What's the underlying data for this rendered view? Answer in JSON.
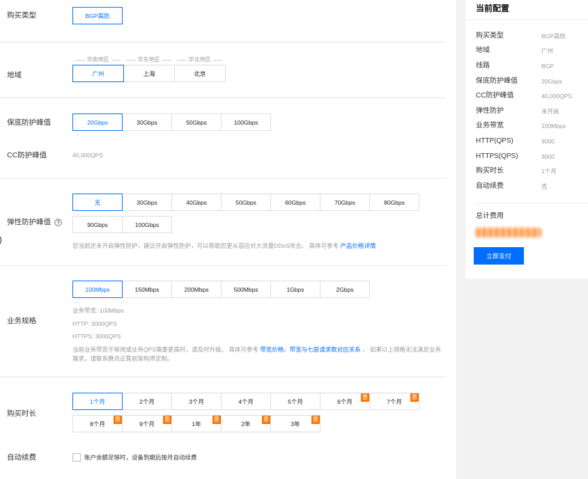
{
  "form": {
    "purchase_type": {
      "label": "购买类型",
      "options": [
        "BGP高防"
      ],
      "selected_index": 0
    },
    "region": {
      "label": "地域",
      "groups": [
        "华南地区",
        "华东地区",
        "华北地区"
      ],
      "options": [
        "广州",
        "上海",
        "北京"
      ],
      "selected_index": 0
    },
    "base_protection": {
      "label": "保底防护峰值",
      "options": [
        "20Gbps",
        "30Gbps",
        "50Gbps",
        "100Gbps"
      ],
      "selected_index": 0
    },
    "cc_protection": {
      "label": "CC防护峰值",
      "value": "40,000QPS"
    },
    "elastic_protection": {
      "label": "弹性防护峰值",
      "help_icon": "question-circle-icon",
      "options": [
        "无",
        "30Gbps",
        "40Gbps",
        "50Gbps",
        "60Gbps",
        "70Gbps",
        "80Gbps",
        "90Gbps",
        "100Gbps"
      ],
      "selected_index": 0,
      "note": "您当前还未开启弹性防护，建议开启弹性防护，可以帮助您更从容应对大流量DDoS攻击。 具体可参考 ",
      "note_link": "产品价格详情"
    },
    "business_spec": {
      "label": "业务规格",
      "options": [
        "100Mbps",
        "150Mbps",
        "200Mbps",
        "500Mbps",
        "1Gbps",
        "2Gbps"
      ],
      "selected_index": 0,
      "details": [
        "业务带宽: 100Mbps",
        "HTTP: 3000QPS",
        "HTTPS: 3000QPS"
      ],
      "note_prefix": "当前业务带宽不够用或业务QPS需要更高时，请及时升级。 具体可参考 ",
      "note_link_1": "带宽价格",
      "note_separator": "、",
      "note_link_2": "带宽与七层请求数对应关系",
      "note_suffix": " 。 如果以上规格无法满足业务需求，请联系腾讯云售前架构师定制。"
    },
    "duration": {
      "label": "购买时长",
      "options": [
        "1个月",
        "2个月",
        "3个月",
        "4个月",
        "5个月",
        "6个月",
        "7个月",
        "8个月",
        "9个月",
        "1年",
        "2年",
        "3年"
      ],
      "selected_index": 0,
      "discount_badge": "惠"
    },
    "auto_renew": {
      "label": "自动续费",
      "checkbox_label": "账户余额足够时，设备到期后按月自动续费",
      "checked": false
    }
  },
  "summary": {
    "title": "当前配置",
    "rows": [
      {
        "label": "购买类型",
        "value": "BGP高防"
      },
      {
        "label": "地域",
        "value": "广州"
      },
      {
        "label": "线路",
        "value": "BGP"
      },
      {
        "label": "保底防护峰值",
        "value": "20Gbps"
      },
      {
        "label": "CC防护峰值",
        "value": "40,000QPS"
      },
      {
        "label": "弹性防护",
        "value": "未开启"
      },
      {
        "label": "业务带宽",
        "value": "100Mbps"
      },
      {
        "label": "HTTP(QPS)",
        "value": "3000"
      },
      {
        "label": "HTTPS(QPS)",
        "value": "3000"
      },
      {
        "label": "购买时长",
        "value": "1个月"
      },
      {
        "label": "自动续费",
        "value": "否"
      }
    ],
    "total_label": "总计费用",
    "pay_button": "立即支付"
  },
  "colors": {
    "accent": "#006eff",
    "badge": "#ff7200",
    "price": "#ff7200",
    "border": "#dddddd",
    "muted_text": "#999999",
    "sidebar_bg": "#f2f2f2"
  }
}
